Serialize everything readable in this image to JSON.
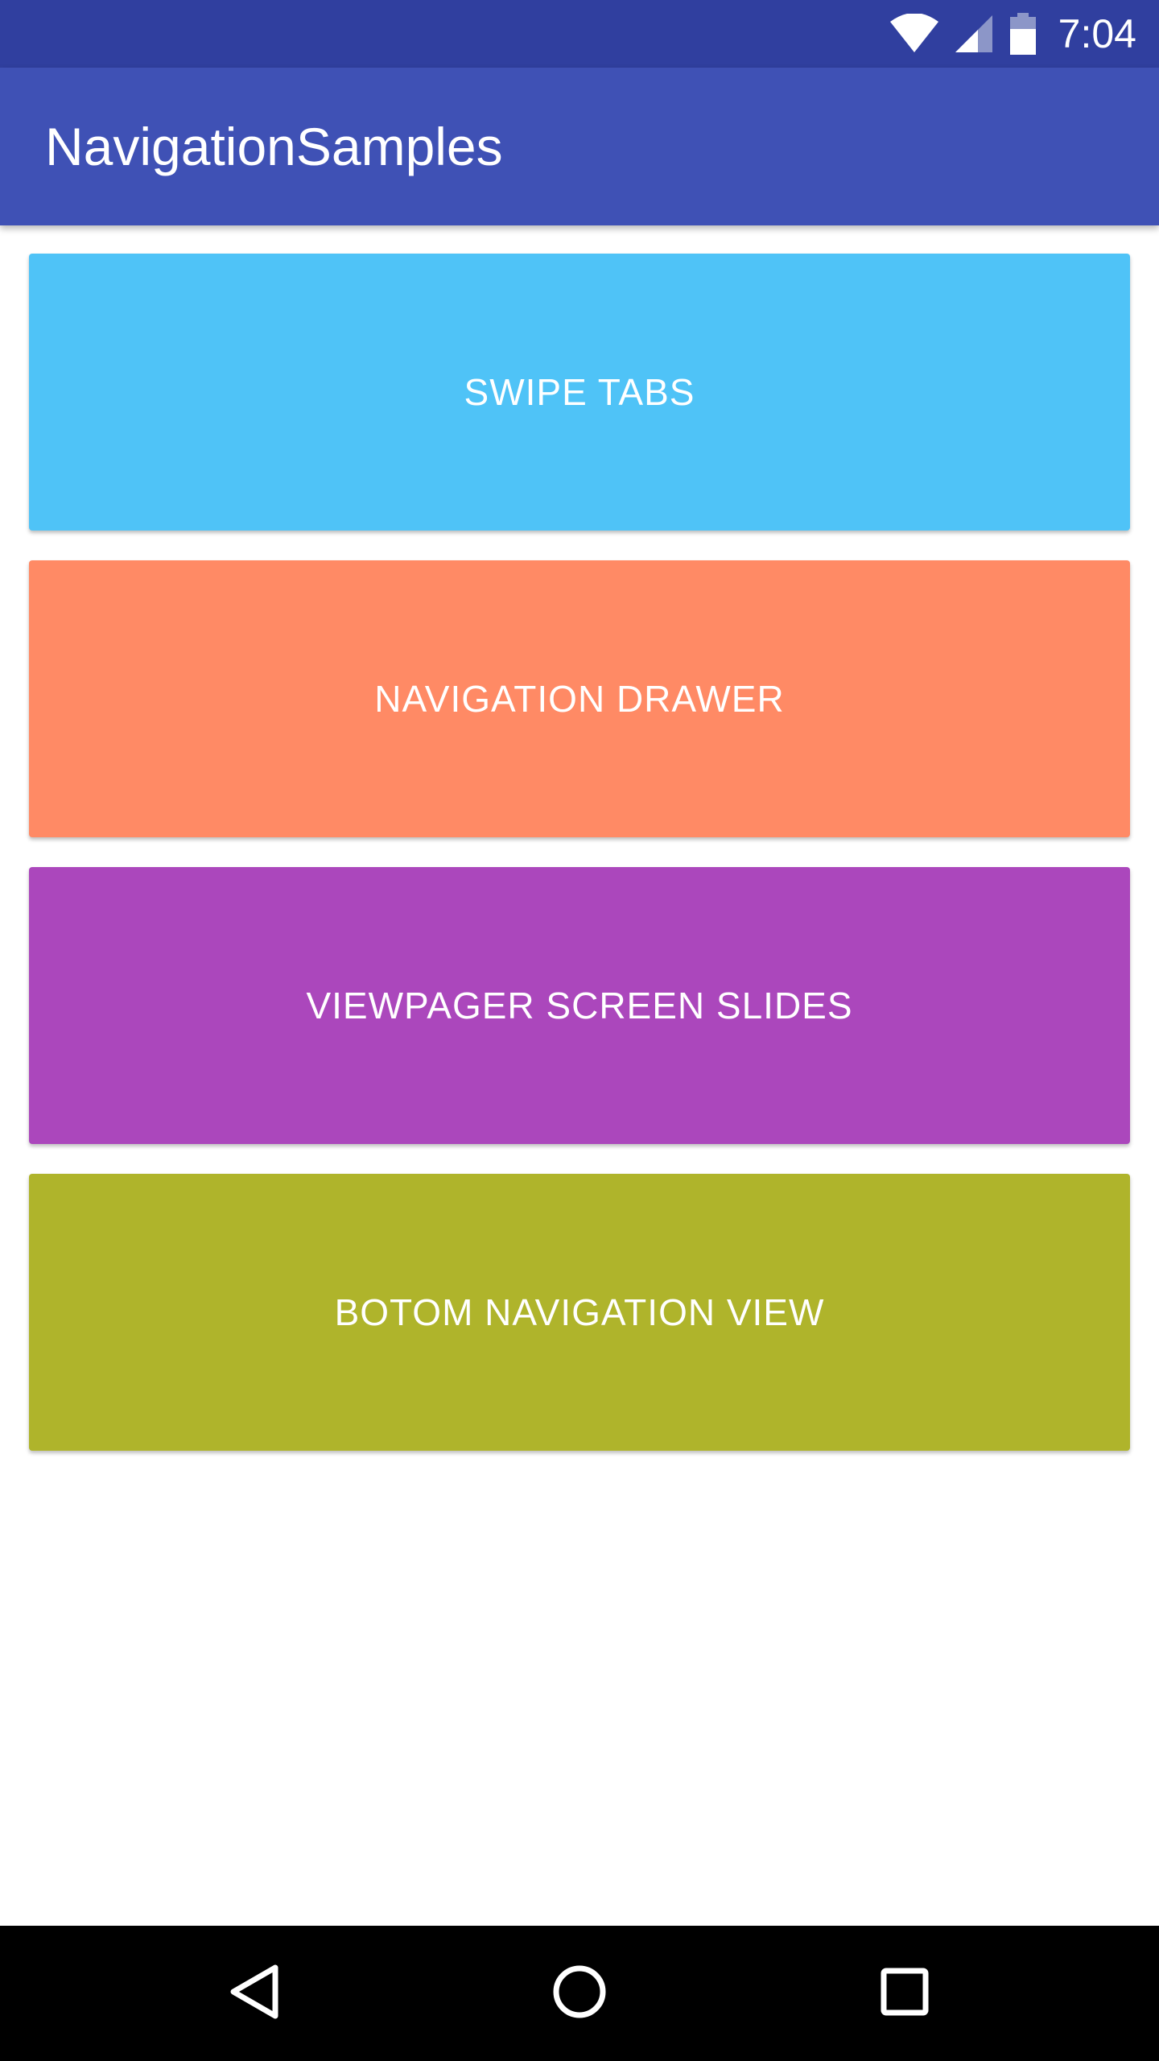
{
  "status_bar": {
    "time": "7:04",
    "icons": [
      "wifi-icon",
      "cell-signal-icon",
      "battery-icon"
    ],
    "background": "#303f9f"
  },
  "app_bar": {
    "title": "NavigationSamples",
    "background": "#3f51b5"
  },
  "buttons": [
    {
      "label": "SWIPE TABS",
      "color": "#4fc3f7"
    },
    {
      "label": "NAVIGATION DRAWER",
      "color": "#ff8a65"
    },
    {
      "label": "VIEWPAGER SCREEN SLIDES",
      "color": "#ab47bc"
    },
    {
      "label": "BOTOM NAVIGATION VIEW",
      "color": "#afb42b"
    }
  ],
  "system_nav": {
    "keys": [
      "back-icon",
      "home-icon",
      "recents-icon"
    ]
  }
}
